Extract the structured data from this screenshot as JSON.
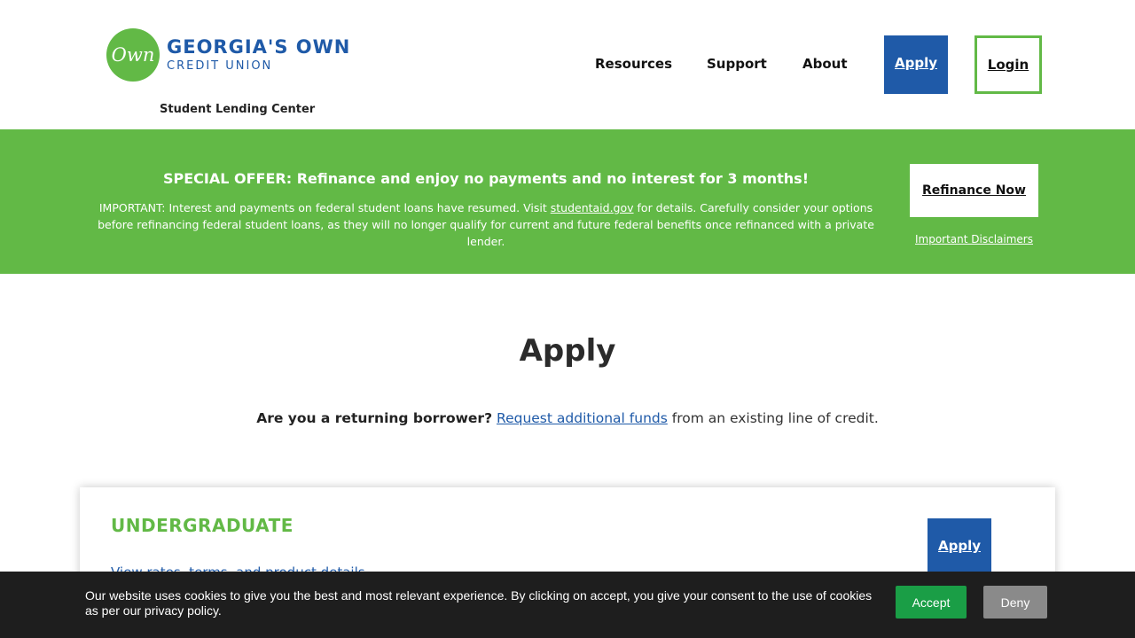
{
  "header": {
    "logo_mark": "Own",
    "logo_line1": "GEORGIA'S OWN",
    "logo_line2": "CREDIT UNION",
    "subtitle": "Student Lending Center",
    "nav": [
      "Resources",
      "Support",
      "About"
    ],
    "apply_label": "Apply",
    "login_label": "Login"
  },
  "banner": {
    "headline": "SPECIAL OFFER: Refinance and enjoy no payments and no interest for 3 months!",
    "text_before": "IMPORTANT: Interest and payments on federal student loans have resumed. Visit ",
    "link_text": "studentaid.gov",
    "text_after": " for details. Carefully consider your options before refinancing federal student loans, as they will no longer qualify for current and future federal benefits once refinanced with a private lender.",
    "refinance_label": "Refinance Now",
    "disclaimers_label": "Important Disclaimers"
  },
  "main": {
    "title": "Apply",
    "returning_question": "Are you a returning borrower?",
    "returning_link": "Request additional funds",
    "returning_after": " from an existing line of credit."
  },
  "card": {
    "title": "UNDERGRADUATE",
    "link": "View rates, terms, and product details",
    "apply_label": "Apply"
  },
  "cookie": {
    "text": "Our website uses cookies to give you the best and most relevant experience. By clicking on accept, you give your consent to the use of cookies as per our privacy policy.",
    "accept_label": "Accept",
    "deny_label": "Deny"
  },
  "colors": {
    "brand_green": "#62b946",
    "brand_blue": "#1f5aa8",
    "cookie_bg": "#1e1e1e",
    "accept_green": "#1a9e46"
  }
}
